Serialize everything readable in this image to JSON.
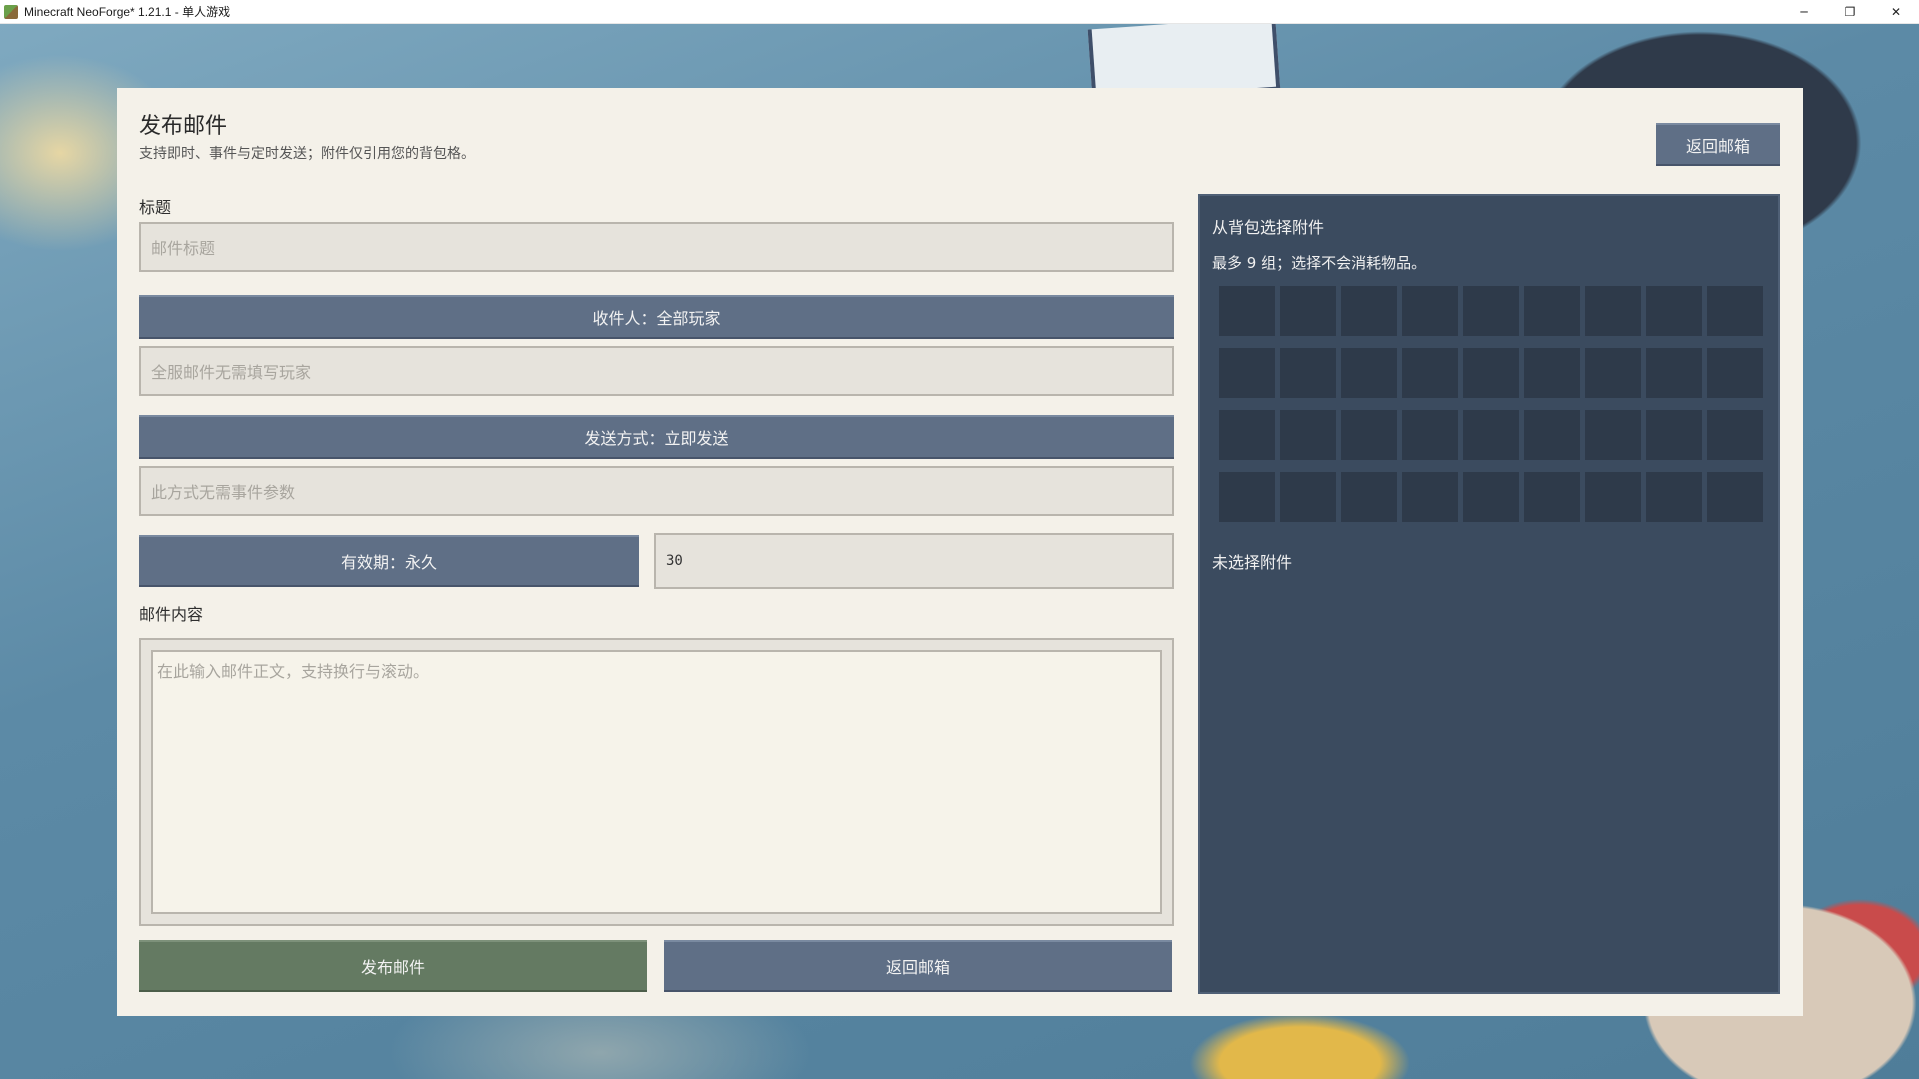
{
  "window": {
    "title": "Minecraft NeoForge* 1.21.1 - 单人游戏",
    "minimize": "─",
    "restore": "❐",
    "close": "✕"
  },
  "header": {
    "title": "发布邮件",
    "subtitle": "支持即时、事件与定时发送；附件仅引用您的背包格。",
    "back_button": "返回邮箱"
  },
  "form": {
    "title_label": "标题",
    "title_placeholder": "邮件标题",
    "recipient_button": "收件人：全部玩家",
    "recipient_placeholder": "全服邮件无需填写玩家",
    "send_mode_button": "发送方式：立即发送",
    "event_placeholder": "此方式无需事件参数",
    "expiry_button": "有效期：永久",
    "expiry_value": "30",
    "content_label": "邮件内容",
    "content_placeholder": "在此输入邮件正文，支持换行与滚动。",
    "publish_button": "发布邮件",
    "return_button": "返回邮箱"
  },
  "attachments": {
    "title": "从背包选择附件",
    "description": "最多 9 组；选择不会消耗物品。",
    "rows": 4,
    "columns": 9,
    "empty_text": "未选择附件"
  },
  "colors": {
    "panel_bg": "#f4f1e9",
    "slate_button": "#5f6f86",
    "green_button": "#647a62",
    "attachment_bg": "#3b4b5f",
    "slot_bg": "#2e3a4a"
  }
}
